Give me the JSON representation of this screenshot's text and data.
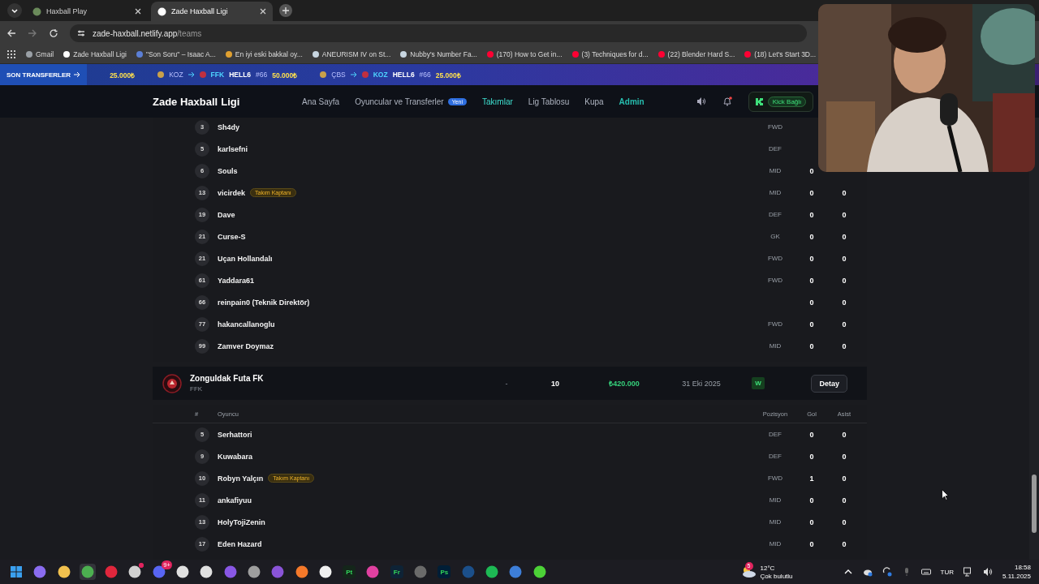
{
  "browser": {
    "tabs": [
      {
        "title": "Haxball Play",
        "selected": false
      },
      {
        "title": "Zade Haxball Ligi",
        "selected": true
      }
    ],
    "address": {
      "host": "zade-haxball.netlify.app",
      "path": "/teams"
    },
    "bookmarks": [
      {
        "label": "Gmail",
        "color": "#9aa0a6"
      },
      {
        "label": "Zade Haxball Ligi",
        "color": "#ffffff"
      },
      {
        "label": "\"Son Soru\" – Isaac A...",
        "color": "#5b7fd6"
      },
      {
        "label": "En iyi eski bakkal oy...",
        "color": "#e0a030"
      },
      {
        "label": "ANEURISM IV on St...",
        "color": "#c7d5e0"
      },
      {
        "label": "Nubby's Number Fa...",
        "color": "#c7d5e0"
      },
      {
        "label": "(170) How to Get in...",
        "color": "#ff0033"
      },
      {
        "label": "(3) Techniques for d...",
        "color": "#ff0033"
      },
      {
        "label": "(22) Blender Hard S...",
        "color": "#ff0033"
      },
      {
        "label": "(18) Let's Start 3D...",
        "color": "#ff0033"
      }
    ]
  },
  "ticker": {
    "label": "SON TRANSFERLER",
    "items": [
      {
        "amount": "25.000₺"
      },
      {
        "from": "KOZ",
        "to": "FFK",
        "player": "HELL6",
        "number": "#66",
        "amount": "50.000₺"
      },
      {
        "from": "ÇBS",
        "to": "KOZ",
        "player": "HELL6",
        "number": "#66",
        "amount": "25.000₺"
      }
    ]
  },
  "nav": {
    "brand": "Zade Haxball",
    "brand_suffix": "Ligi",
    "links": [
      {
        "label": "Ana Sayfa",
        "selected": false,
        "kind": "link"
      },
      {
        "label": "Oyuncular ve Transferler",
        "badge": "Yeni",
        "selected": false,
        "kind": "link"
      },
      {
        "label": "Takımlar",
        "selected": true,
        "kind": "link"
      },
      {
        "label": "Lig Tablosu",
        "selected": false,
        "kind": "link"
      },
      {
        "label": "Kupa",
        "selected": false,
        "kind": "link"
      },
      {
        "label": "Admin",
        "selected": false,
        "kind": "admin"
      }
    ],
    "kick": "Kick Bağlı"
  },
  "teams": [
    {
      "players": [
        {
          "number": "3",
          "name": "Sh4dy",
          "position": "FWD"
        },
        {
          "number": "5",
          "name": "karlsefni",
          "position": "DEF"
        },
        {
          "number": "6",
          "name": "Souls",
          "position": "MID",
          "goals": "0"
        },
        {
          "number": "13",
          "name": "vicirdek",
          "badge": "Takım Kaptanı",
          "position": "MID",
          "goals": "0",
          "assists": "0"
        },
        {
          "number": "19",
          "name": "Dave",
          "position": "DEF",
          "goals": "0",
          "assists": "0"
        },
        {
          "number": "21",
          "name": "Curse-S",
          "position": "GK",
          "goals": "0",
          "assists": "0"
        },
        {
          "number": "21",
          "name": "Uçan Hollandalı",
          "position": "FWD",
          "goals": "0",
          "assists": "0"
        },
        {
          "number": "61",
          "name": "Yaddara61",
          "position": "FWD",
          "goals": "0",
          "assists": "0"
        },
        {
          "number": "66",
          "name": "reinpain0 (Teknik Direktör)",
          "goals": "0",
          "assists": "0"
        },
        {
          "number": "77",
          "name": "hakancallanoglu",
          "position": "FWD",
          "goals": "0",
          "assists": "0"
        },
        {
          "number": "99",
          "name": "Zamver Doymaz",
          "position": "MID",
          "goals": "0",
          "assists": "0"
        }
      ]
    },
    {
      "name": "Zonguldak Futa FK",
      "code": "FFK",
      "column_1": "-",
      "column_2": "10",
      "value": "₺420.000",
      "date": "31 Eki 2025",
      "result": "W",
      "button": "Detay",
      "columns": [
        "#",
        "Oyuncu",
        "Pozisyon",
        "Gol",
        "Asist"
      ],
      "players": [
        {
          "number": "5",
          "name": "Serhattori",
          "position": "DEF",
          "goals": "0",
          "assists": "0"
        },
        {
          "number": "9",
          "name": "Kuwabara",
          "position": "DEF",
          "goals": "0",
          "assists": "0"
        },
        {
          "number": "10",
          "name": "Robyn Yalçın",
          "badge": "Takım Kaptanı",
          "position": "FWD",
          "goals": "1",
          "assists": "0"
        },
        {
          "number": "11",
          "name": "ankafiyuu",
          "position": "MID",
          "goals": "0",
          "assists": "0"
        },
        {
          "number": "13",
          "name": "HolyTojiZenin",
          "position": "MID",
          "goals": "0",
          "assists": "0"
        },
        {
          "number": "17",
          "name": "Eden Hazard",
          "position": "MID",
          "goals": "0",
          "assists": "0"
        }
      ]
    }
  ],
  "taskbar": {
    "apps": [
      {
        "color": "#3aa0f0",
        "kind": "windows"
      },
      {
        "color": "#8a6cf0"
      },
      {
        "color": "#f2c14e"
      },
      {
        "color": "#4caf50",
        "selected": true
      },
      {
        "color": "#e0263c"
      },
      {
        "color": "#d0d0d0",
        "alert": true
      },
      {
        "color": "#5865f2",
        "badge": "9+"
      },
      {
        "color": "#e0e0e0"
      },
      {
        "color": "#e0e0e0"
      },
      {
        "color": "#8957e5"
      },
      {
        "color": "#9e9e9e"
      },
      {
        "color": "#8a54d8"
      },
      {
        "color": "#f5792a"
      },
      {
        "color": "#f0f0f0"
      },
      {
        "color": "#14261a",
        "label": "Pt"
      },
      {
        "color": "#e040a0"
      },
      {
        "color": "#0e2336",
        "label": "Fr"
      },
      {
        "color": "#6a6a6a"
      },
      {
        "color": "#001e36",
        "label": "Ps"
      },
      {
        "color": "#1b4f8a"
      },
      {
        "color": "#1db954"
      },
      {
        "color": "#3d7ed8"
      },
      {
        "color": "#4cd137"
      }
    ],
    "weather": {
      "temp": "12°C",
      "text": "Çok bulutlu",
      "badge": "5"
    },
    "language": "TUR",
    "time": "18:58",
    "date": "5.11.2025"
  }
}
